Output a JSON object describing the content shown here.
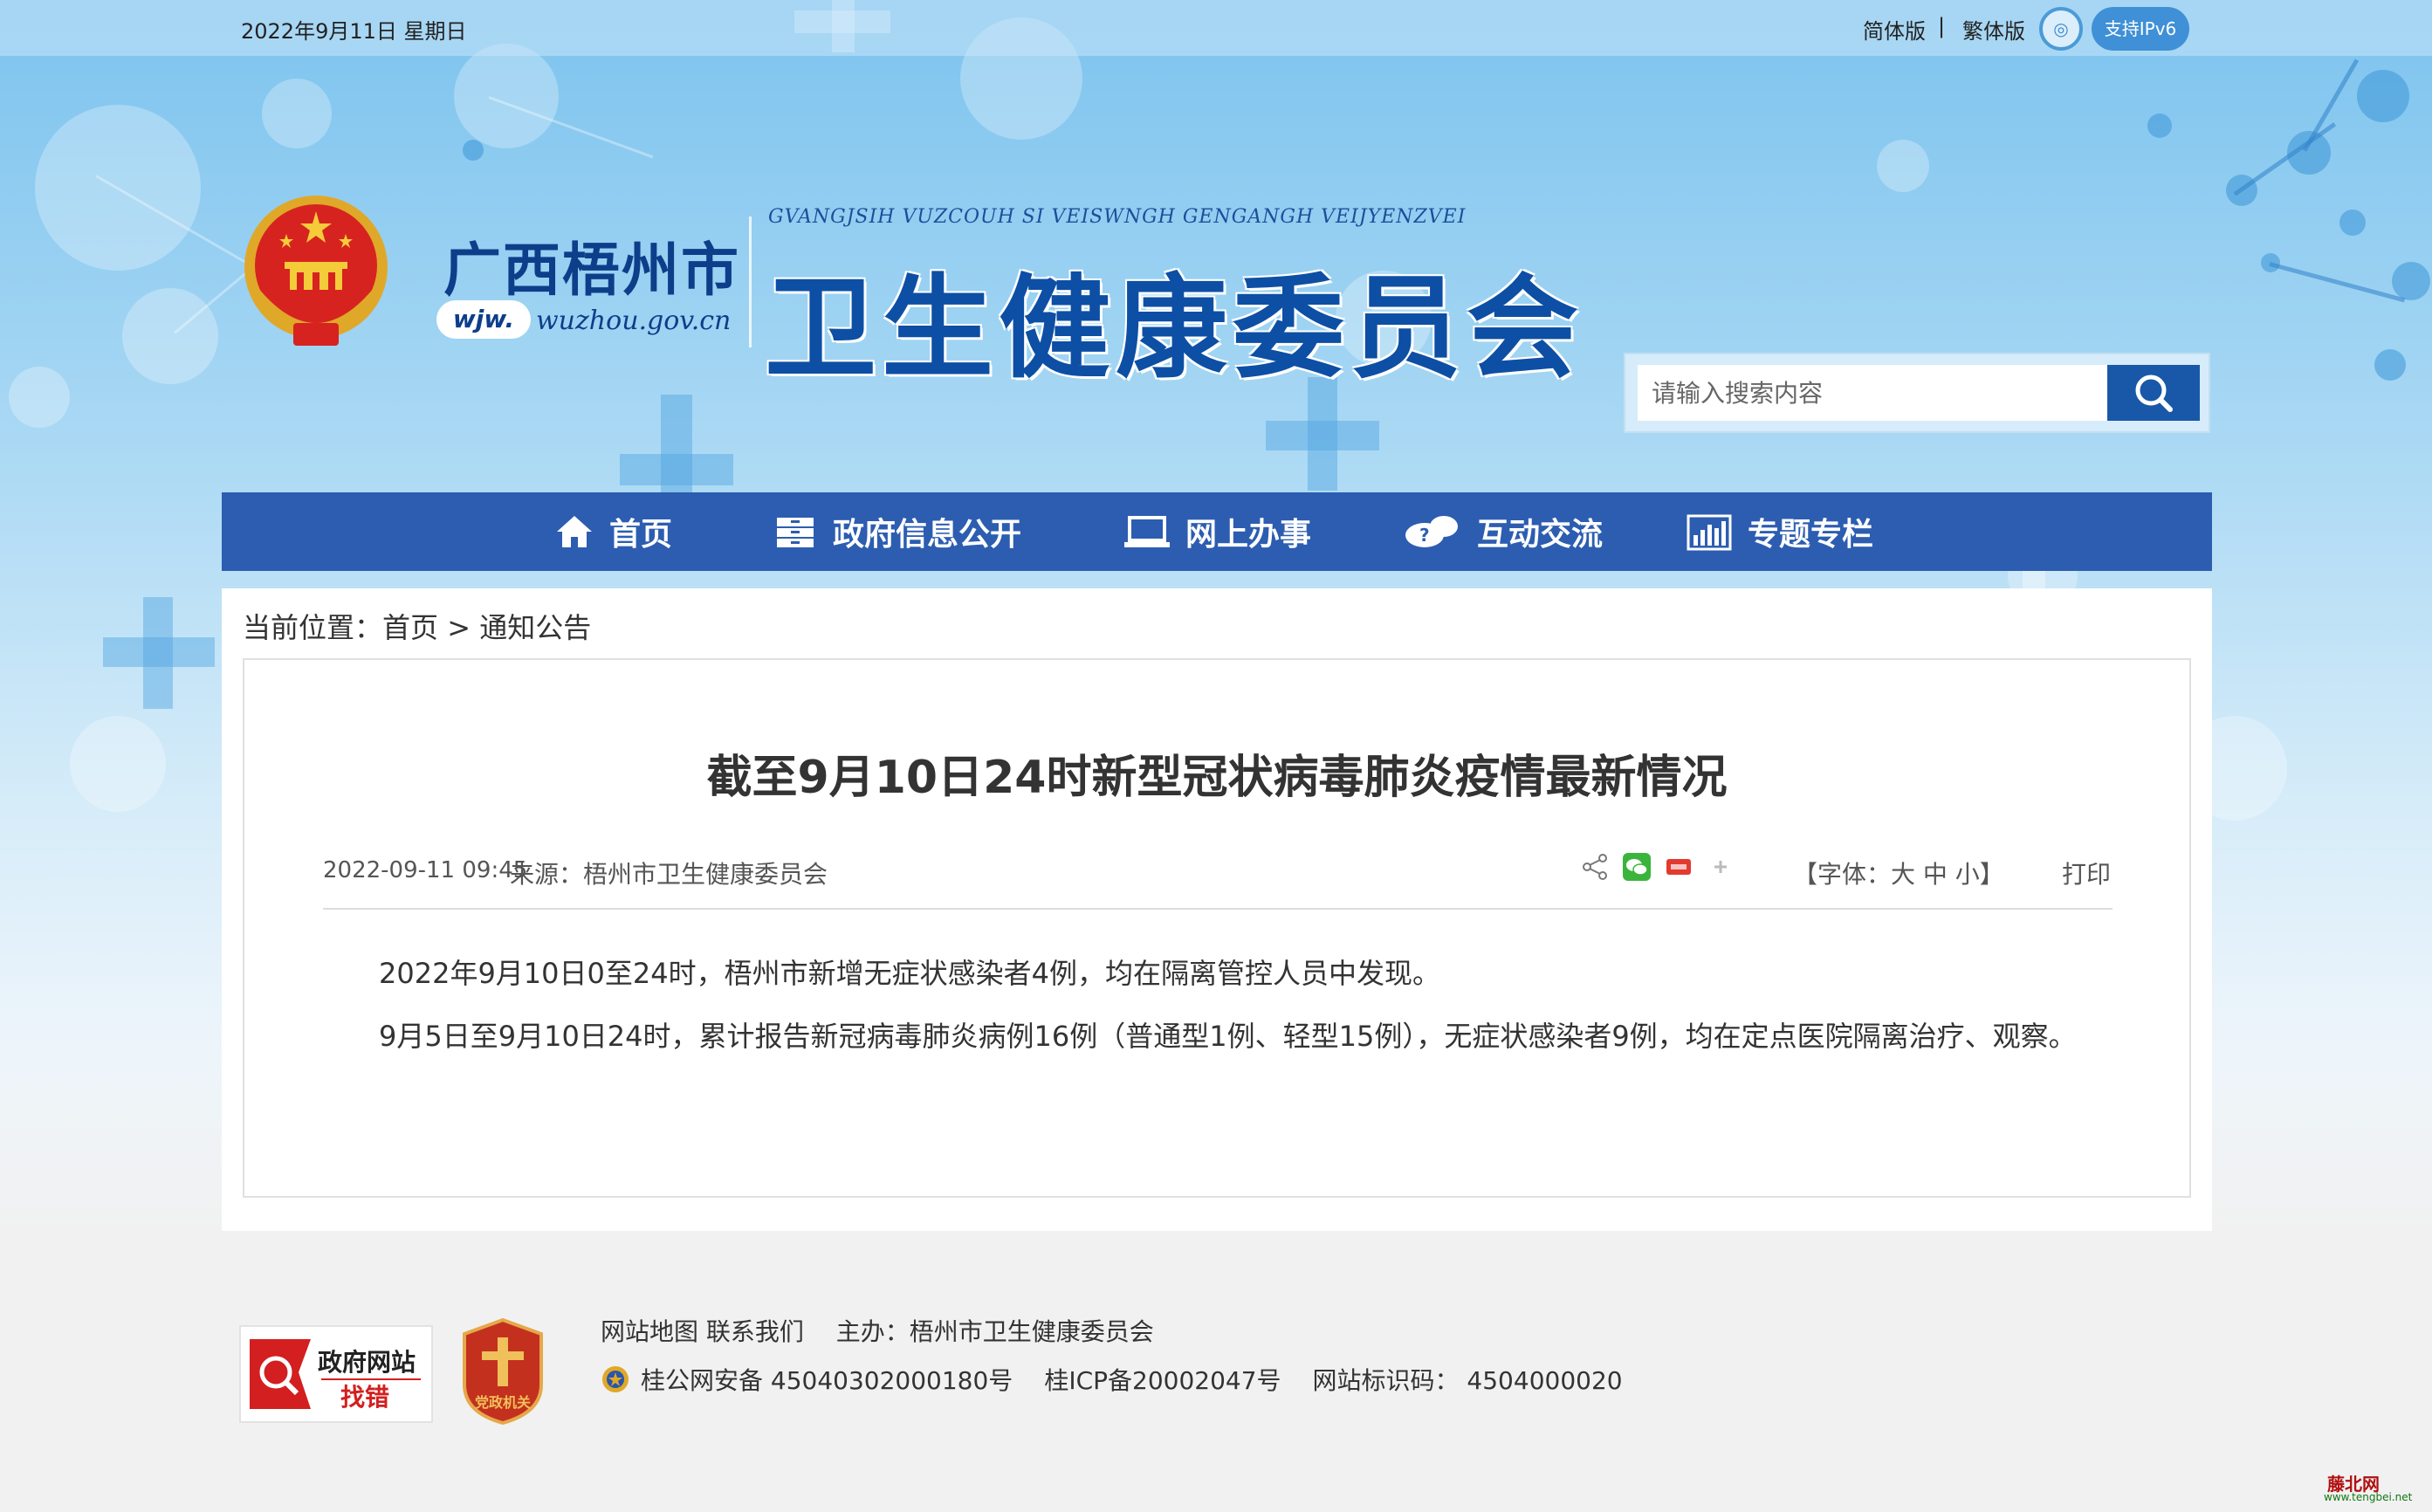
{
  "topbar": {
    "date": "2022年9月11日 星期日",
    "simplified": "简体版",
    "separator": "|",
    "traditional": "繁体版",
    "ipv6_icon": "ipv6-badge-icon",
    "ipv6_label": "支持IPv6"
  },
  "header": {
    "city": "广西梧州市",
    "domain_prefix": "wjw.",
    "domain": "wuzhou.gov.cn",
    "zhuang_name": "GVANGJSIH VUZCOUH SI VEISWNGH GENGANGH VEIJYENZVEI",
    "org_name": "卫生健康委员会"
  },
  "search": {
    "placeholder": "请输入搜索内容",
    "button_icon": "search-icon"
  },
  "nav": {
    "items": [
      {
        "label": "首页",
        "icon": "home-icon"
      },
      {
        "label": "政府信息公开",
        "icon": "cabinet-icon"
      },
      {
        "label": "网上办事",
        "icon": "laptop-icon"
      },
      {
        "label": "互动交流",
        "icon": "chat-icon"
      },
      {
        "label": "专题专栏",
        "icon": "bar-chart-icon"
      }
    ]
  },
  "breadcrumb": {
    "prefix": "当前位置：",
    "home": "首页",
    "sep": ">",
    "current": "通知公告"
  },
  "article": {
    "title": "截至9月10日24时新型冠状病毒肺炎疫情最新情况",
    "datetime": "2022-09-11 09:45",
    "source": "来源：梧州市卫生健康委员会",
    "font_label": "【字体：大 中 小】",
    "print": "打印",
    "share_icons": [
      "share-icon",
      "wechat-icon",
      "weibo-icon",
      "plus-icon"
    ],
    "paragraphs": [
      "2022年9月10日0至24时，梧州市新增无症状感染者4例，均在隔离管控人员中发现。",
      "9月5日至9月10日24时，累计报告新冠病毒肺炎病例16例（普通型1例、轻型15例），无症状感染者9例，均在定点医院隔离治疗、观察。"
    ]
  },
  "footer": {
    "badge_text_1": "政府网站",
    "badge_text_2": "找错",
    "badge2_text": "党政机关",
    "links": "网站地图 联系我们 　主办：梧州市卫生健康委员会",
    "police": "桂公网安备 45040302000180号",
    "icp": "桂ICP备20002047号",
    "site_id": "网站标识码： 4504000020"
  },
  "watermark": {
    "name": "藤北网",
    "url": "www.tengbei.net"
  },
  "colors": {
    "nav_bg": "#2c5db1",
    "brand_blue": "#0d4fa4",
    "search_btn": "#1958a8"
  }
}
